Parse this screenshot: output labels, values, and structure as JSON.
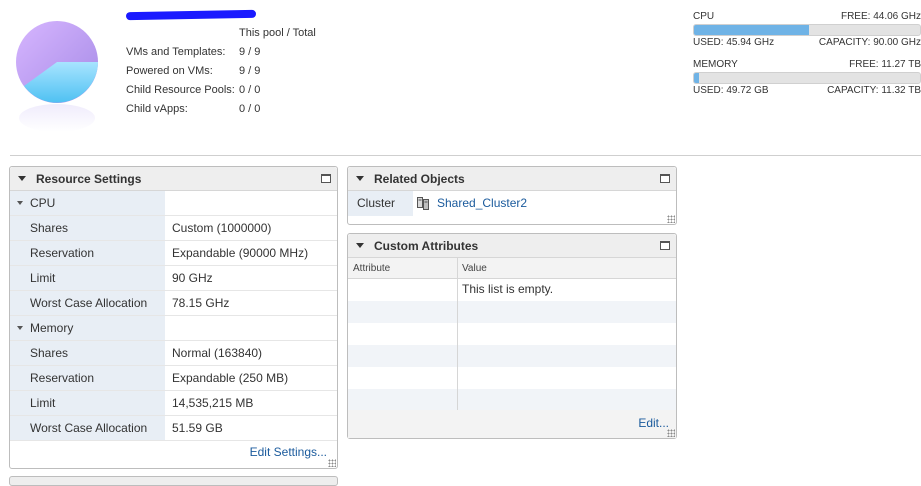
{
  "summary": {
    "header": "This pool / Total",
    "rows": [
      {
        "label": "VMs and Templates:",
        "value": "9 / 9"
      },
      {
        "label": "Powered on VMs:",
        "value": "9 / 9"
      },
      {
        "label": "Child Resource Pools:",
        "value": "0 / 0"
      },
      {
        "label": "Child vApps:",
        "value": "0 / 0"
      }
    ]
  },
  "meters": {
    "cpu": {
      "label": "CPU",
      "free": "FREE: 44.06 GHz",
      "used": "USED: 45.94 GHz",
      "capacity": "CAPACITY: 90.00 GHz",
      "fraction": 0.51
    },
    "memory": {
      "label": "MEMORY",
      "free": "FREE: 11.27 TB",
      "used": "USED: 49.72 GB",
      "capacity": "CAPACITY: 11.32 TB",
      "fraction": 0.02
    }
  },
  "resource_settings": {
    "title": "Resource Settings",
    "cpu_group": "CPU",
    "cpu_rows": [
      {
        "label": "Shares",
        "value": "Custom (1000000)"
      },
      {
        "label": "Reservation",
        "value": "Expandable (90000 MHz)"
      },
      {
        "label": "Limit",
        "value": "90 GHz"
      },
      {
        "label": "Worst Case Allocation",
        "value": "78.15 GHz"
      }
    ],
    "memory_group": "Memory",
    "memory_rows": [
      {
        "label": "Shares",
        "value": "Normal (163840)"
      },
      {
        "label": "Reservation",
        "value": "Expandable (250 MB)"
      },
      {
        "label": "Limit",
        "value": "14,535,215 MB"
      },
      {
        "label": "Worst Case Allocation",
        "value": "51.59 GB"
      }
    ],
    "edit_label": "Edit Settings..."
  },
  "related_objects": {
    "title": "Related Objects",
    "cluster_label": "Cluster",
    "cluster_value": "Shared_Cluster2"
  },
  "custom_attributes": {
    "title": "Custom Attributes",
    "col_attribute": "Attribute",
    "col_value": "Value",
    "empty_text": "This list is empty.",
    "edit_label": "Edit..."
  },
  "colors": {
    "accent_link": "#1a5a9c",
    "meter_fill": "#6fb3e6",
    "key_cell_bg": "#e8eef5",
    "redaction": "#1a1aff"
  },
  "icons": [
    "resource-pool-pie-icon",
    "cluster-icon",
    "collapse-triangle-icon",
    "maximize-icon",
    "resize-grip-icon"
  ]
}
